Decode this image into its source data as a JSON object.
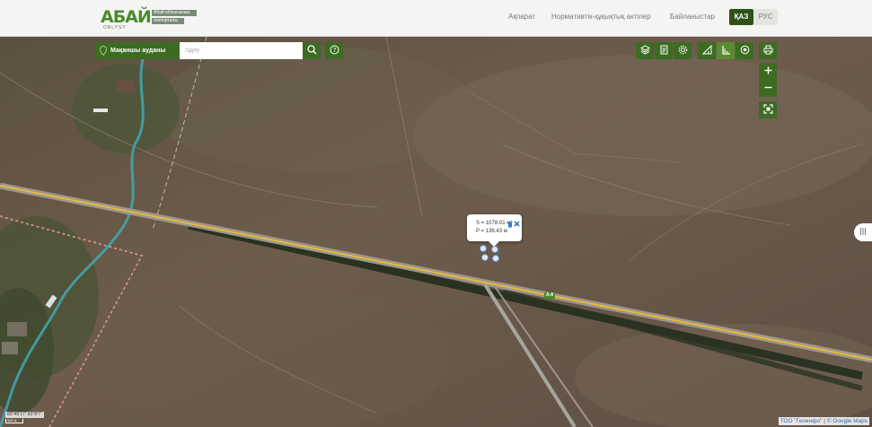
{
  "header": {
    "logo_word": "АБАЙ",
    "logo_sub": "OBLYSY",
    "logo_tag_1": "Абай облысының",
    "logo_tag_2": "геопорталы",
    "nav": [
      "Ақпарат",
      "Нормативтік-құқықтық актілер",
      "Байланыстар"
    ],
    "lang_active": "ҚАЗ",
    "lang_inactive": "РУС"
  },
  "search": {
    "district_label": "Мақаншы ауданы",
    "placeholder": "Іздеу"
  },
  "popup": {
    "area_text": "S = 1078.01 м²",
    "perimeter_text": "P = 139.43 м"
  },
  "map_labels": {
    "road": "А-8",
    "coords": "80°45'17\" 82°8'7\"",
    "scale": "500 м"
  },
  "attribution": {
    "text": "ТОО \"Геоинфо\"",
    "separator": " | ",
    "copyright": "© Google Maps"
  },
  "icons": {
    "district": "location-pin-icon",
    "search": "search-icon",
    "help": "help-icon",
    "layers": "layers-icon",
    "legend": "legend-icon",
    "settings": "gear-icon",
    "measure_distance": "ruler-icon",
    "measure_area": "area-measure-icon",
    "point": "target-icon",
    "print": "print-icon",
    "zoom_in": "plus-icon",
    "zoom_out": "minus-icon",
    "full_extent": "fullscreen-icon",
    "handle": "drag-handle-icon",
    "popup_delete": "trash-icon",
    "popup_close": "close-icon"
  },
  "colors": {
    "brand_dark": "#3d6b22",
    "brand_light": "#5a8a32",
    "brand_logo": "#4a8a2a"
  }
}
